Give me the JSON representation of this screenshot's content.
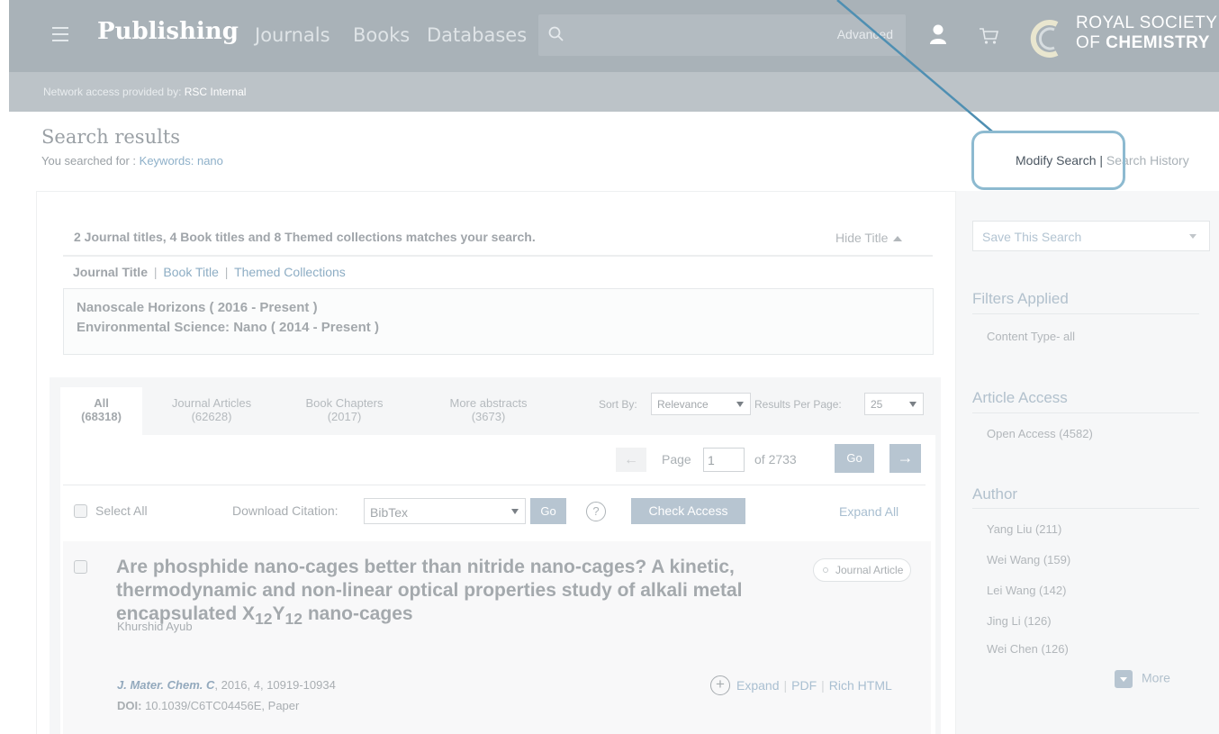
{
  "header": {
    "brand": "Publishing",
    "nav": [
      "Journals",
      "Books",
      "Databases"
    ],
    "search_placeholder": "",
    "advanced_label": "Advanced",
    "logo_line1": "ROYAL SOCIETY",
    "logo_line2_prefix": "OF ",
    "logo_line2_bold": "CHEMISTRY",
    "access_prefix": "Network access provided by: ",
    "access_org": "RSC Internal"
  },
  "heading": {
    "title": "Search results",
    "searched_prefix": "You searched for : ",
    "searched_keywords": "Keywords: nano",
    "modify_search": "Modify Search",
    "link_sep": " | ",
    "search_history": "Search History"
  },
  "titles": {
    "match_text": "2 Journal titles, 4 Book titles and 8 Themed collections matches your search.",
    "hide_title": "Hide Title",
    "tab_journal": "Journal Title",
    "tab_book": "Book Title",
    "tab_themed": "Themed Collections",
    "sep": "|",
    "journals": [
      "Nanoscale Horizons ( 2016 - Present )",
      "Environmental Science: Nano ( 2014 - Present )"
    ]
  },
  "results": {
    "tabs": [
      {
        "label": "All",
        "count": "(68318)"
      },
      {
        "label": "Journal Articles",
        "count": "(62628)"
      },
      {
        "label": "Book Chapters",
        "count": "(2017)"
      },
      {
        "label": "More abstracts",
        "count": "(3673)"
      }
    ],
    "sort_by_label": "Sort By:",
    "sort_by_value": "Relevance",
    "rpp_label": "Results Per Page:",
    "rpp_value": "25",
    "prev_arrow": "←",
    "next_arrow": "→",
    "page_label": "Page",
    "page_value": "1",
    "of_label": "of 2733",
    "go_label": "Go",
    "select_all": "Select All",
    "download_label": "Download Citation:",
    "citation_format": "BibTex",
    "help": "?",
    "check_access": "Check Access",
    "expand_all": "Expand All"
  },
  "article": {
    "title_main": "Are phosphide nano-cages better than nitride nano-cages? A kinetic, thermodynamic and non-linear optical properties study of alkali metal encapsulated X",
    "sub1": "12",
    "mid": "Y",
    "sub2": "12",
    "title_end": " nano-cages",
    "type": "Journal Article",
    "authors": "Khurshid Ayub",
    "journal": "J. Mater. Chem. C",
    "cite_rest": ", 2016, 4, 10919-10934",
    "doi_label": "DOI:",
    "doi_rest": " 10.1039/C6TC04456E, Paper",
    "plus": "+",
    "expand": "Expand",
    "pdf": "PDF",
    "rich_html": "Rich HTML",
    "bar": "|"
  },
  "sidebar": {
    "save_search": "Save This Search",
    "filters_heading": "Filters Applied",
    "filter_item": "Content Type- all",
    "access_heading": "Article Access",
    "access_item": "Open Access (4582)",
    "author_heading": "Author",
    "authors": [
      "Yang Liu (211)",
      "Wei Wang (159)",
      "Lei Wang (142)",
      "Jing Li (126)",
      "Wei Chen (126)"
    ],
    "more": "More"
  },
  "colors": {
    "header_bg": "#a9b2b8",
    "accent_link": "#8eb0c9",
    "button": "#b7c5d1",
    "callout": "#8dbad0"
  }
}
